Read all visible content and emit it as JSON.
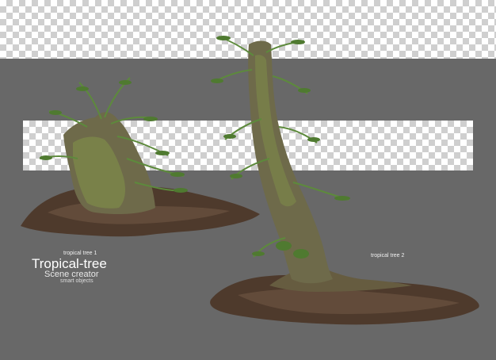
{
  "labels": {
    "tree1": "tropical  tree 1",
    "title": "Tropical-tree",
    "subtitle": "Scene creator",
    "smart": "smart objects",
    "tree2": "tropical  tree 2"
  },
  "colors": {
    "background_gray": "#686868",
    "checker_gray": "#cfcfcf",
    "soil": "#4e3a2c",
    "bark": "#6e6a4a",
    "fern": "#5d8a3c"
  }
}
